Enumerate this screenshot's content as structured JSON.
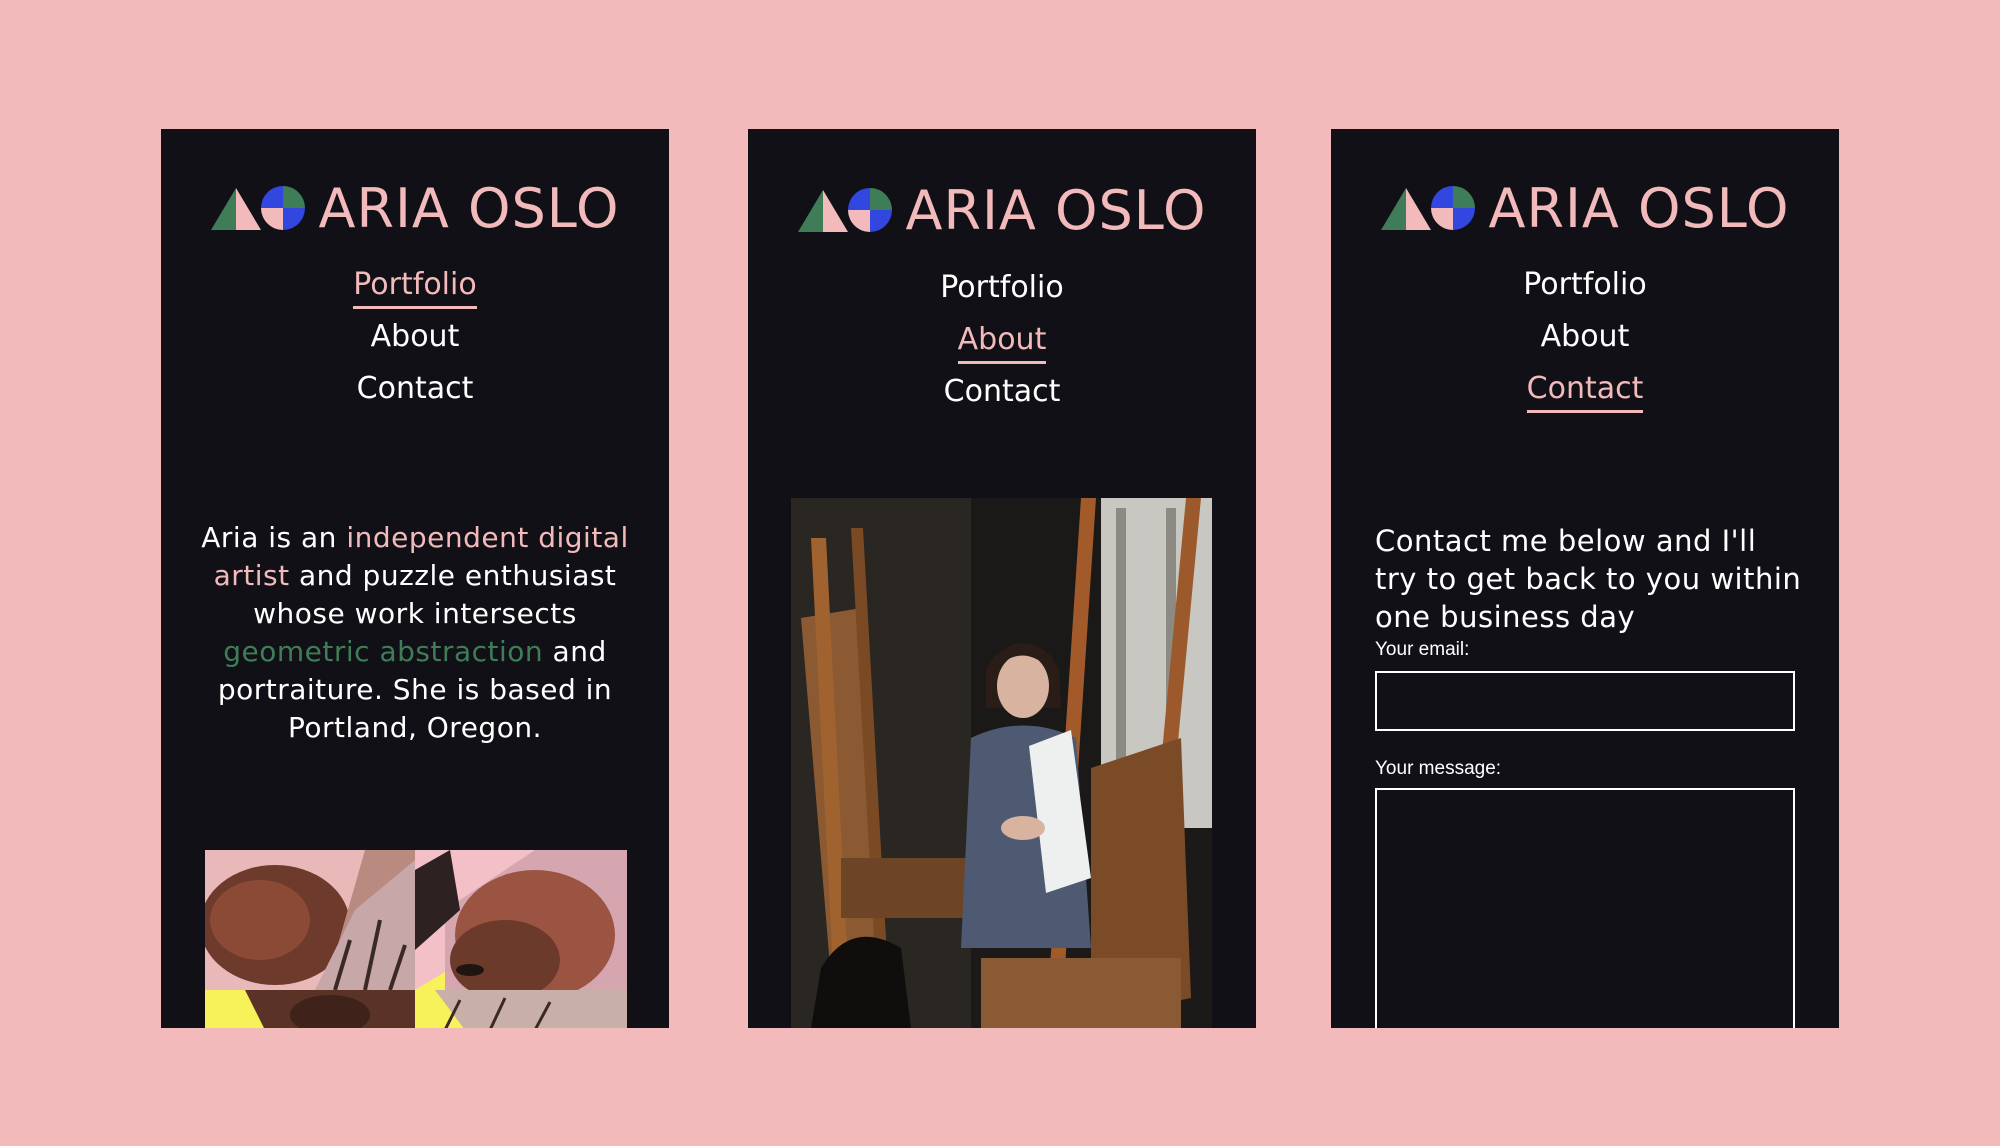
{
  "brand": {
    "name": "ARIA OSLO",
    "logo_icon": "triangle-circle-logo-icon"
  },
  "nav": {
    "portfolio": "Portfolio",
    "about": "About",
    "contact": "Contact"
  },
  "screens": [
    {
      "active_nav": "Portfolio"
    },
    {
      "active_nav": "About"
    },
    {
      "active_nav": "Contact"
    }
  ],
  "portfolio": {
    "bio": [
      {
        "text": "Aria is an "
      },
      {
        "text": "independent digital artist",
        "accent": "pink"
      },
      {
        "text": " and puzzle enthusiast whose work intersects "
      },
      {
        "text": "geometric abstraction",
        "accent": "green"
      },
      {
        "text": " and portraiture. She is based in Portland, Oregon."
      }
    ]
  },
  "contact": {
    "intro": "Contact me below and I'll try to get back to you within one business day",
    "email_label": "Your email:",
    "message_label": "Your message:"
  },
  "colors": {
    "background": "#f3babc",
    "screen": "#111016",
    "pink_accent": "#f3babc",
    "green_accent": "#3e7d57",
    "blue_accent": "#3246e0",
    "collage_yellow": "#f7f25a"
  }
}
